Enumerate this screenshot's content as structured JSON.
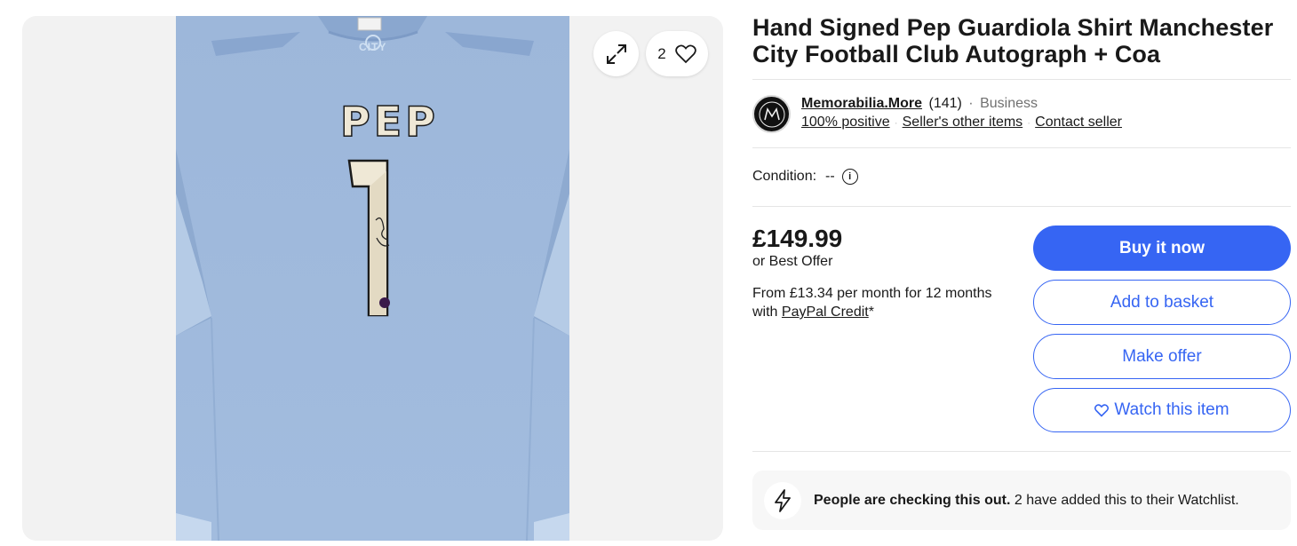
{
  "gallery": {
    "watch_count": "2",
    "expand_icon": "expand-icon",
    "heart_icon": "heart-icon",
    "shirt": {
      "club_text": "CITY",
      "name": "PEP",
      "number": "1"
    }
  },
  "listing": {
    "title": "Hand Signed Pep Guardiola Shirt Manchester City Football Club Autograph + Coa"
  },
  "seller": {
    "name": "Memorabilia.More",
    "feedback_count": "(141)",
    "separator": "·",
    "type": "Business",
    "positive": "100% positive",
    "other_items": "Seller's other items",
    "contact": "Contact seller"
  },
  "condition": {
    "label": "Condition:",
    "value": "--"
  },
  "pricing": {
    "price": "£149.99",
    "best_offer": "or Best Offer",
    "credit_text": "From £13.34 per month for 12 months with",
    "credit_link": "PayPal Credit",
    "credit_suffix": "*"
  },
  "actions": {
    "buy_now": "Buy it now",
    "add_basket": "Add to basket",
    "make_offer": "Make offer",
    "watch": "Watch this item"
  },
  "signal": {
    "bold": "People are checking this out.",
    "text": "2 have added this to their Watchlist."
  },
  "colors": {
    "primary": "#3665f3",
    "text": "#191919",
    "shirt": "#9fb9dc"
  }
}
